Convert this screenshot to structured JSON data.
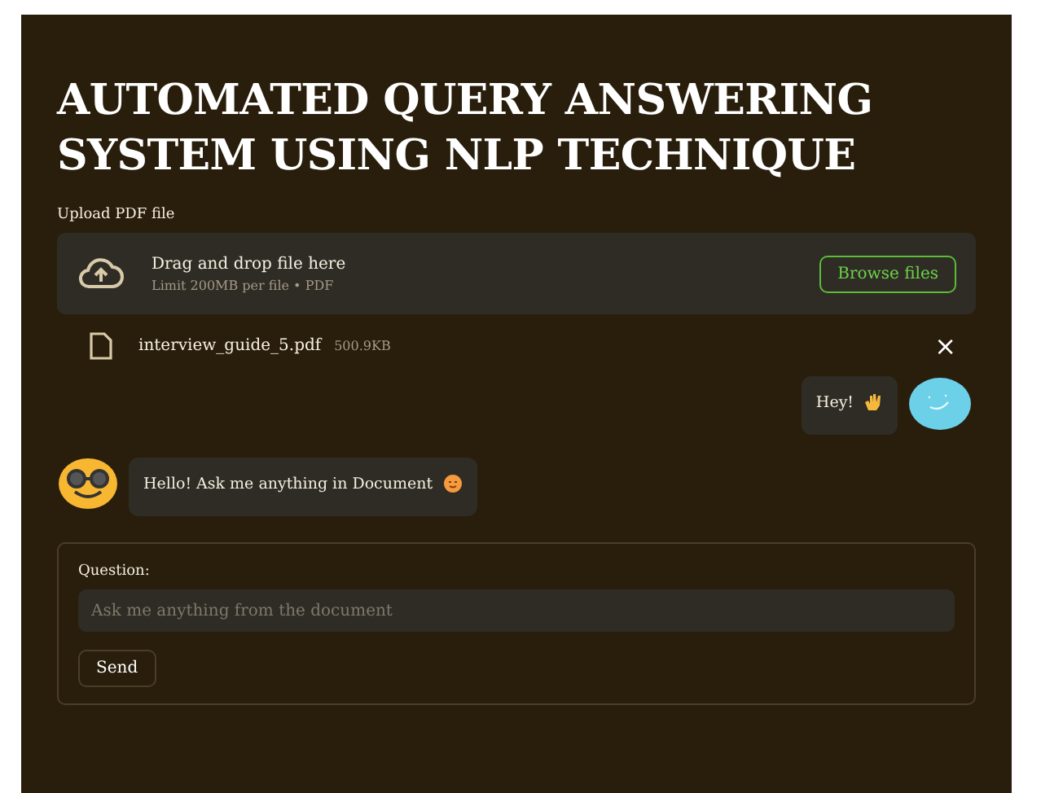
{
  "title": "AUTOMATED QUERY ANSWERING SYSTEM USING NLP TECHNIQUE",
  "uploader": {
    "label": "Upload PDF file",
    "drop_text": "Drag and drop file here",
    "limit": "Limit 200MB per file • PDF",
    "button": "Browse files"
  },
  "file": {
    "name": "interview_guide_5.pdf",
    "size": "500.9KB",
    "remove": "×"
  },
  "messages": [
    {
      "kind": "user",
      "text": "Hey!"
    },
    {
      "kind": "bot",
      "text": "Hello! Ask me anything in Document"
    }
  ],
  "form": {
    "label": "Question:",
    "placeholder": "Ask me anything from the document",
    "button": "Send"
  }
}
